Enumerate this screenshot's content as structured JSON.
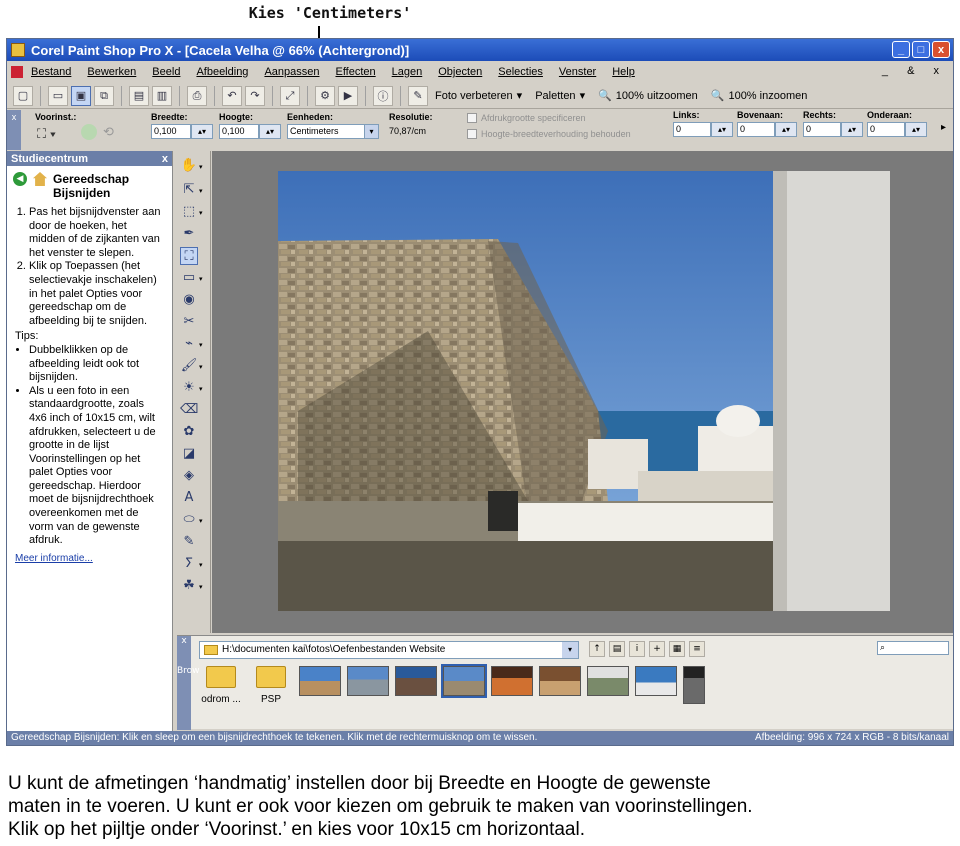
{
  "annotation": {
    "label": "Kies 'Centimeters'"
  },
  "window": {
    "title": "Corel Paint Shop Pro X - [Cacela Velha @  66% (Achtergrond)]",
    "controls": [
      "_",
      "□",
      "x"
    ],
    "mdi_controls": "_ & x"
  },
  "menu": {
    "items": [
      "Bestand",
      "Bewerken",
      "Beeld",
      "Afbeelding",
      "Aanpassen",
      "Effecten",
      "Lagen",
      "Objecten",
      "Selecties",
      "Venster",
      "Help"
    ]
  },
  "toolbar": {
    "foto_verbeteren": "Foto verbeteren",
    "paletten": "Paletten",
    "zoom_out": "100% uitzoomen",
    "zoom_in": "100% inzoomen"
  },
  "options": {
    "voorinst_label": "Voorinst.:",
    "breedte_label": "Breedte:",
    "breedte_value": "0,100",
    "hoogte_label": "Hoogte:",
    "hoogte_value": "0,100",
    "eenheden_label": "Eenheden:",
    "eenheden_value": "Centimeters",
    "resolutie_label": "Resolutie:",
    "resolutie_value": "70,87/cm",
    "afdruk_label": "Afdrukgrootte specificeren",
    "hoogte_breedte_label": "Hoogte-breedteverhouding behouden",
    "links_label": "Links:",
    "links_value": "0",
    "boven_label": "Bovenaan:",
    "boven_value": "0",
    "rechts_label": "Rechts:",
    "rechts_value": "0",
    "onder_label": "Onderaan:",
    "onder_value": "0"
  },
  "panel": {
    "title": "Studiecentrum",
    "heading_1": "Gereedschap",
    "heading_2": "Bijsnijden",
    "step1": "Pas het bijsnijdvenster aan door de hoeken, het midden of de zijkanten van het venster te slepen.",
    "step2": "Klik op Toepassen (het selectievakje inschakelen) in het palet Opties voor gereedschap om de afbeelding bij te snijden.",
    "tips_label": "Tips:",
    "tip1": "Dubbelklikken op de afbeelding leidt ook tot bijsnijden.",
    "tip2": "Als u een foto in een standaardgrootte, zoals 4x6 inch of 10x15 cm, wilt afdrukken, selecteert u de grootte in de lijst Voorinstellingen op het palet Opties voor gereedschap. Hierdoor moet de bijsnijdrechthoek overeenkomen met de vorm van de gewenste afdruk.",
    "more_link": "Meer informatie..."
  },
  "browser": {
    "side_label": "Brow",
    "path": "H:\\documenten kai\\fotos\\Oefenbestanden Website",
    "folders": [
      "odrom ...",
      "PSP"
    ],
    "thumb_count": 9
  },
  "status": {
    "left": "Gereedschap Bijsnijden: Klik en sleep om een bijsnijdrechthoek te tekenen. Klik met de rechtermuisknop om te wissen.",
    "right": "Afbeelding:  996 x 724 x RGB - 8 bits/kanaal"
  },
  "caption": {
    "line1": "U kunt de afmetingen ‘handmatig’ instellen door bij Breedte en Hoogte de gewenste",
    "line2": "maten in te voeren. U kunt er ook voor kiezen om gebruik te maken van voorinstellingen.",
    "line3": "Klik op het pijltje onder ‘Voorinst.’ en kies voor 10x15 cm horizontaal."
  },
  "colors": {
    "titlebar": "#1c4cb8",
    "panel_header": "#6b7fa8",
    "workspace": "#7a7a7a",
    "sky": "#4a7ec6",
    "sea": "#2a6aa0"
  }
}
